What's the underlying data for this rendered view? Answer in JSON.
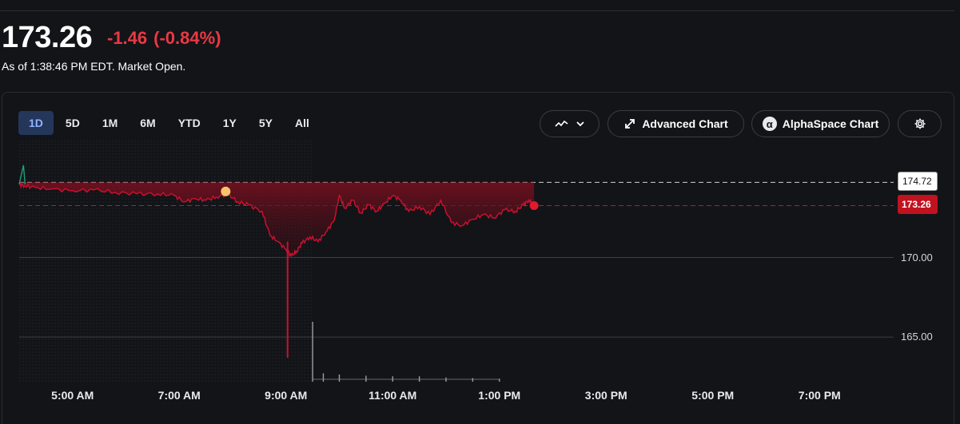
{
  "quote": {
    "price": "173.26",
    "change": "-1.46",
    "change_pct": "(-0.84%)",
    "as_of": "As of 1:38:46 PM EDT. Market Open."
  },
  "toolbar": {
    "ranges": [
      "1D",
      "5D",
      "1M",
      "6M",
      "YTD",
      "1Y",
      "5Y",
      "All"
    ],
    "active_range": "1D",
    "chart_type_icon": "line-chart-icon",
    "advanced_chart_label": "Advanced Chart",
    "alphaspace_chart_label": "AlphaSpace Chart",
    "settings_icon": "gear-icon"
  },
  "colors": {
    "down": "#ea3943",
    "line": "#c8102e",
    "prev_close_line": "#ffffff",
    "up_premarket": "#1aa37a",
    "event_dot": "#f7c46c",
    "volume": "#9aa0a6",
    "background": "#131418"
  },
  "chart_data": {
    "type": "line",
    "x_unit": "hours (EDT)",
    "x_ticks": [
      "5:00 AM",
      "7:00 AM",
      "9:00 AM",
      "11:00 AM",
      "1:00 PM",
      "3:00 PM",
      "5:00 PM",
      "7:00 PM"
    ],
    "x_tick_values": [
      5,
      7,
      9,
      11,
      13,
      15,
      17,
      19
    ],
    "xlim": [
      4,
      20
    ],
    "y_ticks": [
      170.0,
      165.0
    ],
    "ylim": [
      162.2,
      177.4
    ],
    "previous_close": 174.72,
    "current_price": 173.26,
    "last_time": 13.65,
    "premarket_spike": {
      "x": 4.08,
      "y": 175.8
    },
    "event_marker": {
      "x": 7.87,
      "y": 174.15
    },
    "low_wick": {
      "x": 9.03,
      "low": 163.7
    },
    "series": [
      {
        "x": [
          4.0,
          4.1,
          4.3,
          4.6,
          5.0,
          5.4,
          5.8,
          6.2,
          6.6,
          6.9,
          7.1,
          7.3,
          7.5,
          7.7,
          7.9,
          8.1,
          8.3,
          8.55,
          8.7,
          8.85,
          9.0,
          9.1,
          9.2,
          9.3,
          9.45,
          9.6,
          9.75,
          9.9,
          10.0,
          10.1,
          10.25,
          10.4,
          10.55,
          10.7,
          10.85,
          11.0,
          11.15,
          11.3,
          11.5,
          11.7,
          11.9,
          12.1,
          12.3,
          12.5,
          12.7,
          12.9,
          13.1,
          13.3,
          13.45,
          13.55,
          13.65
        ],
        "y": [
          174.6,
          174.5,
          174.4,
          174.3,
          174.2,
          174.25,
          174.1,
          174.0,
          174.0,
          173.9,
          173.5,
          173.7,
          173.6,
          173.8,
          174.0,
          173.5,
          173.3,
          172.9,
          171.4,
          171.0,
          170.5,
          170.1,
          170.4,
          170.9,
          171.3,
          171.0,
          171.6,
          172.3,
          173.9,
          173.1,
          173.6,
          172.8,
          173.3,
          172.9,
          173.4,
          173.9,
          173.6,
          172.9,
          173.2,
          172.7,
          173.6,
          172.2,
          172.0,
          172.4,
          172.7,
          172.5,
          173.0,
          172.9,
          173.3,
          173.6,
          173.26
        ]
      }
    ],
    "volume": {
      "x": [
        9.5,
        9.7,
        10.0,
        10.5,
        11.0,
        11.5,
        12.0,
        12.5,
        13.0
      ],
      "values": [
        1.0,
        0.14,
        0.12,
        0.1,
        0.09,
        0.09,
        0.07,
        0.06,
        0.05
      ]
    }
  }
}
